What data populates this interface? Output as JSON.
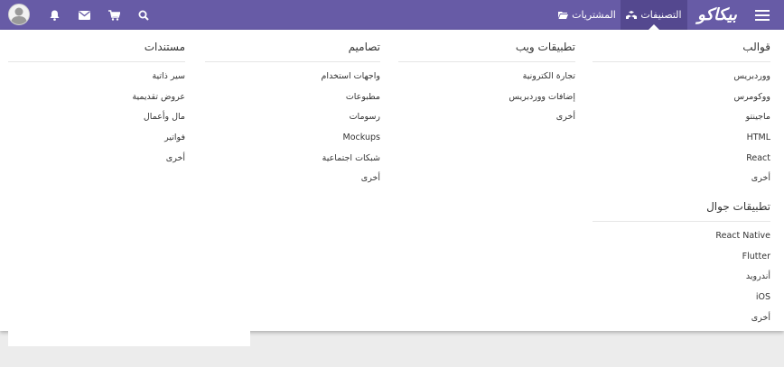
{
  "navbar": {
    "logo_text": "بيكاكو",
    "categories_label": "التصنيفات",
    "purchases_label": "المشتريات",
    "bg_color": "#675ba6",
    "active_bg": "#54488f"
  },
  "menu": {
    "templates": {
      "heading": "قوالب",
      "items": [
        "ووردبريس",
        "ووكومرس",
        "ماجينتو",
        "HTML",
        "React",
        "أخرى"
      ]
    },
    "mobile_apps": {
      "heading": "تطبيقات جوال",
      "items": [
        "React Native",
        "Flutter",
        "أندرويد",
        "iOS",
        "أخرى"
      ]
    },
    "web_apps": {
      "heading": "تطبيقات ويب",
      "items": [
        "تجارة الكترونية",
        "إضافات ووردبريس",
        "أخرى"
      ]
    },
    "designs": {
      "heading": "تصاميم",
      "items": [
        "واجهات استخدام",
        "مطبوعات",
        "رسومات",
        "Mockups",
        "شبكات اجتماعية",
        "أخرى"
      ]
    },
    "documents": {
      "heading": "مستندات",
      "items": [
        "سير ذاتية",
        "عروض تقديمية",
        "مال وأعمال",
        "فواتير",
        "أخرى"
      ]
    }
  }
}
